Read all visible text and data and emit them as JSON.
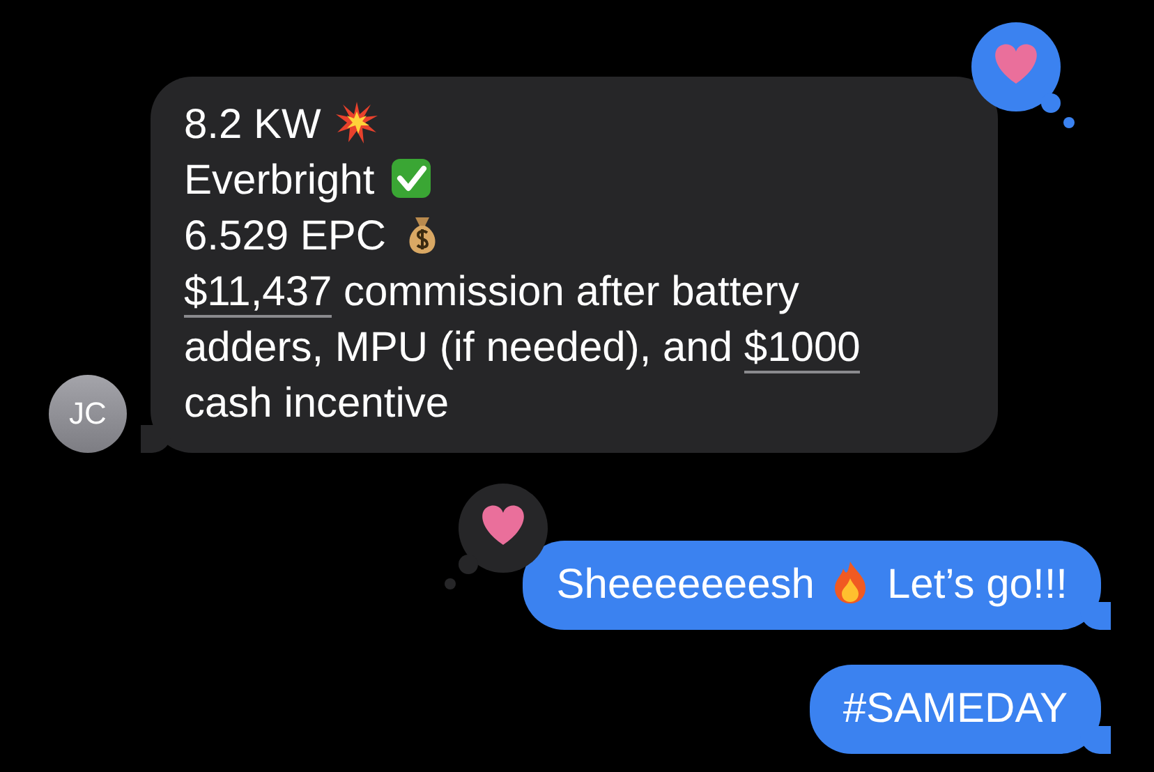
{
  "messages": [
    {
      "kind": "incoming",
      "sender_initials": "JC",
      "reaction": {
        "kind": "heart",
        "mine": true
      },
      "paragraphs": [
        [
          {
            "kind": "text",
            "text": "8.2 KW"
          },
          {
            "kind": "collision_emoji"
          }
        ],
        [
          {
            "kind": "text",
            "text": "Everbright"
          },
          {
            "kind": "check_emoji"
          }
        ],
        [
          {
            "kind": "text",
            "text": "6.529 EPC"
          },
          {
            "kind": "money_bag_emoji"
          }
        ],
        [
          {
            "kind": "link",
            "text": "$11,437"
          },
          {
            "kind": "text",
            "text": " commission after battery adders, MPU (if needed), and "
          },
          {
            "kind": "link",
            "text": "$1000"
          },
          {
            "kind": "text",
            "text": " cash incentive"
          }
        ]
      ]
    },
    {
      "kind": "outgoing",
      "reaction": {
        "kind": "heart",
        "mine": false
      },
      "paragraphs": [
        [
          {
            "kind": "text",
            "text": "Sheeeeeeesh"
          },
          {
            "kind": "fire_emoji"
          },
          {
            "kind": "text",
            "text": "Let’s go!!!"
          }
        ]
      ]
    },
    {
      "kind": "outgoing",
      "paragraphs": [
        [
          {
            "kind": "text",
            "text": "#SAMEDAY"
          }
        ]
      ]
    }
  ]
}
